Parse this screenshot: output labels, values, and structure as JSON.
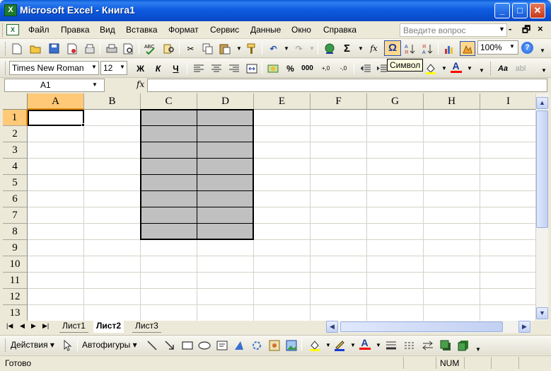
{
  "window": {
    "title": "Microsoft Excel - Книга1",
    "app_icon_label": "X",
    "minimize": "_",
    "maximize": "□",
    "close": "✕"
  },
  "menu": {
    "items": [
      "Файл",
      "Правка",
      "Вид",
      "Вставка",
      "Формат",
      "Сервис",
      "Данные",
      "Окно",
      "Справка"
    ],
    "help_placeholder": "Введите вопрос",
    "doc_minimize": "-",
    "doc_restore": "🗗",
    "doc_close": "×"
  },
  "standard_toolbar": {
    "zoom": "100%",
    "tooltip": "Символ",
    "omega": "Ω",
    "sigma": "Σ",
    "fx": "fx",
    "help": "?"
  },
  "formatting_toolbar": {
    "font_name": "Times New Roman",
    "font_size": "12",
    "bold": "Ж",
    "italic": "К",
    "underline": "Ч",
    "percent": "%",
    "thousands": "000",
    "font_color_letter": "A"
  },
  "formula_bar": {
    "cell_ref": "A1",
    "fx_label": "fx",
    "value": ""
  },
  "grid": {
    "columns": [
      "A",
      "B",
      "C",
      "D",
      "E",
      "F",
      "G",
      "H",
      "I"
    ],
    "rows": [
      "1",
      "2",
      "3",
      "4",
      "5",
      "6",
      "7",
      "8",
      "9",
      "10",
      "11",
      "12",
      "13"
    ],
    "active_cell": "A1",
    "shaded_range": "C1:D8"
  },
  "sheets": {
    "tabs": [
      "Лист1",
      "Лист2",
      "Лист3"
    ],
    "active": "Лист2"
  },
  "drawing_toolbar": {
    "actions": "Действия",
    "autoshapes": "Автофигуры",
    "font_color_letter": "A"
  },
  "status": {
    "ready": "Готово",
    "num": "NUM"
  },
  "colors": {
    "title_bar": "#0a4fd0",
    "selected_header": "#ffc978",
    "shaded_fill": "#c0c0c0",
    "tooltip_bg": "#ffffe1"
  }
}
